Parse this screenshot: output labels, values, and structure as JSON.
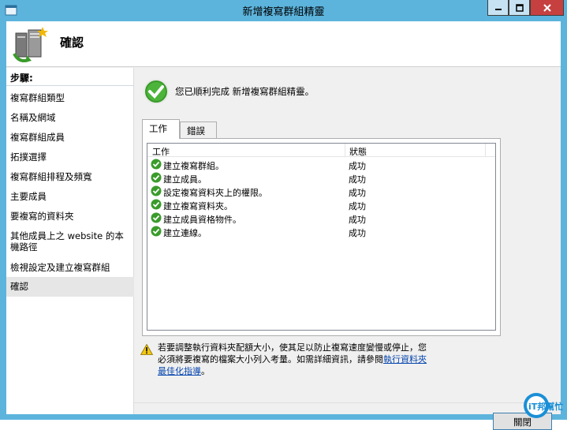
{
  "window": {
    "title": "新增複寫群組精靈",
    "buttons": {
      "minimize": "minimize-icon",
      "maximize": "maximize-icon",
      "close": "close-icon"
    }
  },
  "header": {
    "title": "確認"
  },
  "sidebar": {
    "heading": "步驟:",
    "items": [
      {
        "label": "複寫群組類型"
      },
      {
        "label": "名稱及網域"
      },
      {
        "label": "複寫群組成員"
      },
      {
        "label": "拓撲選擇"
      },
      {
        "label": "複寫群組排程及頻寬"
      },
      {
        "label": "主要成員"
      },
      {
        "label": "要複寫的資料夾"
      },
      {
        "label": "其他成員上之 website 的本機路徑"
      },
      {
        "label": "檢視設定及建立複寫群組"
      },
      {
        "label": "確認",
        "active": true
      }
    ]
  },
  "main": {
    "success_message": "您已順利完成 新增複寫群組精靈。",
    "tabs": [
      {
        "label": "工作",
        "selected": true
      },
      {
        "label": "錯誤",
        "selected": false
      }
    ],
    "table": {
      "columns": [
        "工作",
        "狀態"
      ],
      "rows": [
        {
          "task": "建立複寫群組。",
          "status": "成功"
        },
        {
          "task": "建立成員。",
          "status": "成功"
        },
        {
          "task": "設定複寫資料夾上的權限。",
          "status": "成功"
        },
        {
          "task": "建立複寫資料夾。",
          "status": "成功"
        },
        {
          "task": "建立成員資格物件。",
          "status": "成功"
        },
        {
          "task": "建立連線。",
          "status": "成功"
        }
      ]
    },
    "warning": {
      "text_before_link": "若要調整執行資料夾配額大小，使其足以防止複寫速度變慢或停止，您必須將要複寫的檔案大小列入考量。如需詳細資訊，請參閱",
      "link": "執行資料夾最佳化指導",
      "text_after_link": "。"
    },
    "close_button": "關閉"
  },
  "watermark": {
    "text": "iT邦幫忙"
  },
  "colors": {
    "titlebar": "#5cb4dd",
    "close_button": "#c74040",
    "success_green": "#3a9b2b",
    "link": "#0645ad"
  }
}
